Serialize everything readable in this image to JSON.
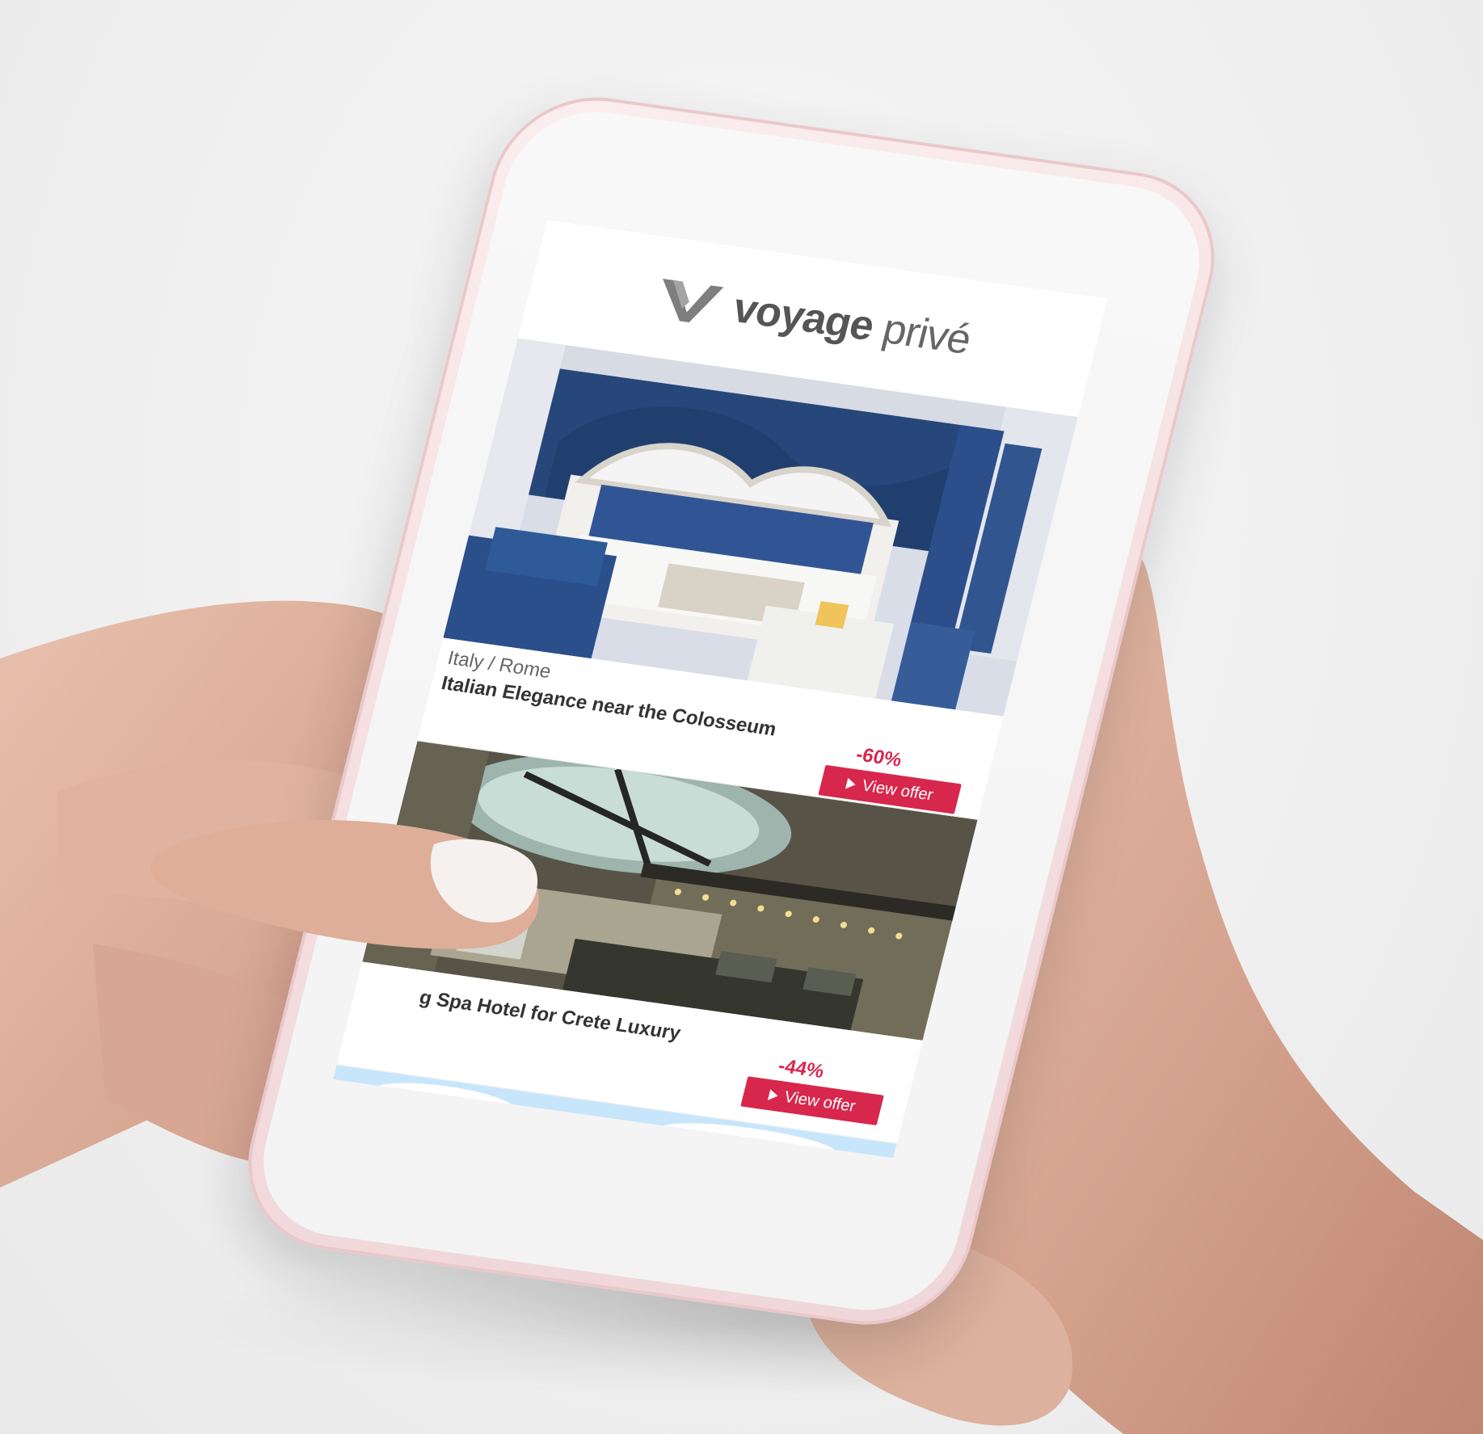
{
  "brand": {
    "name": "voyage",
    "suffix": "privé"
  },
  "offers": [
    {
      "location": "Italy / Rome",
      "title": "Italian Elegance near the Colosseum",
      "discount": "-60%",
      "button_label": "View offer"
    },
    {
      "title": "g Spa Hotel for Crete Luxury",
      "discount": "-44%",
      "button_label": "View offer"
    }
  ],
  "colors": {
    "accent": "#d7274d",
    "phone_frame": "#efd6d8",
    "room_blue": "#27467a",
    "sea": "#3bbbc8"
  },
  "icons": {
    "brand_mark": "v-logo-icon",
    "button_play": "play-icon"
  }
}
